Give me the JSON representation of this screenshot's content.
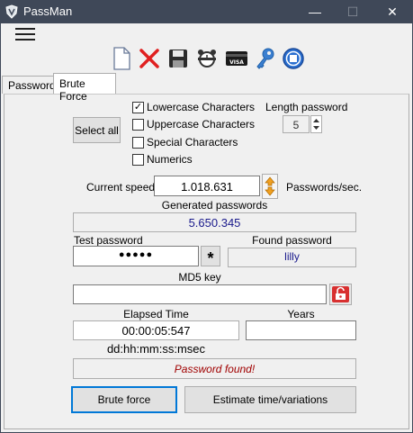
{
  "window": {
    "title": "PassMan",
    "minimize": "—",
    "maximize": "☐",
    "close": "✕"
  },
  "menu": {
    "hamburger": "☰"
  },
  "toolbar": {
    "icons": [
      "new-document-icon",
      "delete-icon",
      "save-icon",
      "alarm-clock-icon",
      "visa-card-icon",
      "key-icon",
      "stop-icon"
    ]
  },
  "tabs": [
    {
      "label": "Password"
    },
    {
      "label": "Brute Force"
    }
  ],
  "options": {
    "select_all": "Select all",
    "lowercase": {
      "label": "Lowercase Characters",
      "checked": true
    },
    "uppercase": {
      "label": "Uppercase Characters",
      "checked": false
    },
    "special": {
      "label": "Special Characters",
      "checked": false
    },
    "numerics": {
      "label": "Numerics",
      "checked": false
    },
    "length_label": "Length password",
    "length_value": "5"
  },
  "speed": {
    "label": "Current speed",
    "value": "1.018.631",
    "unit": "Passwords/sec."
  },
  "generated": {
    "label": "Generated passwords",
    "value": "5.650.345"
  },
  "test": {
    "label": "Test password",
    "value": "●●●●●",
    "star": "*"
  },
  "found": {
    "label": "Found password",
    "value": "lilly"
  },
  "md5": {
    "label": "MD5 key",
    "value": ""
  },
  "elapsed": {
    "label": "Elapsed Time",
    "value": "00:00:05:547",
    "format": "dd:hh:mm:ss:msec"
  },
  "years": {
    "label": "Years",
    "value": ""
  },
  "status": {
    "text": "Password found!"
  },
  "actions": {
    "brute_force": "Brute force",
    "estimate": "Estimate time/variations"
  },
  "colors": {
    "titlebar": "#3f4858",
    "accent": "#0078d7",
    "status_text": "#a00000",
    "value_blue": "#1a1a8c"
  }
}
